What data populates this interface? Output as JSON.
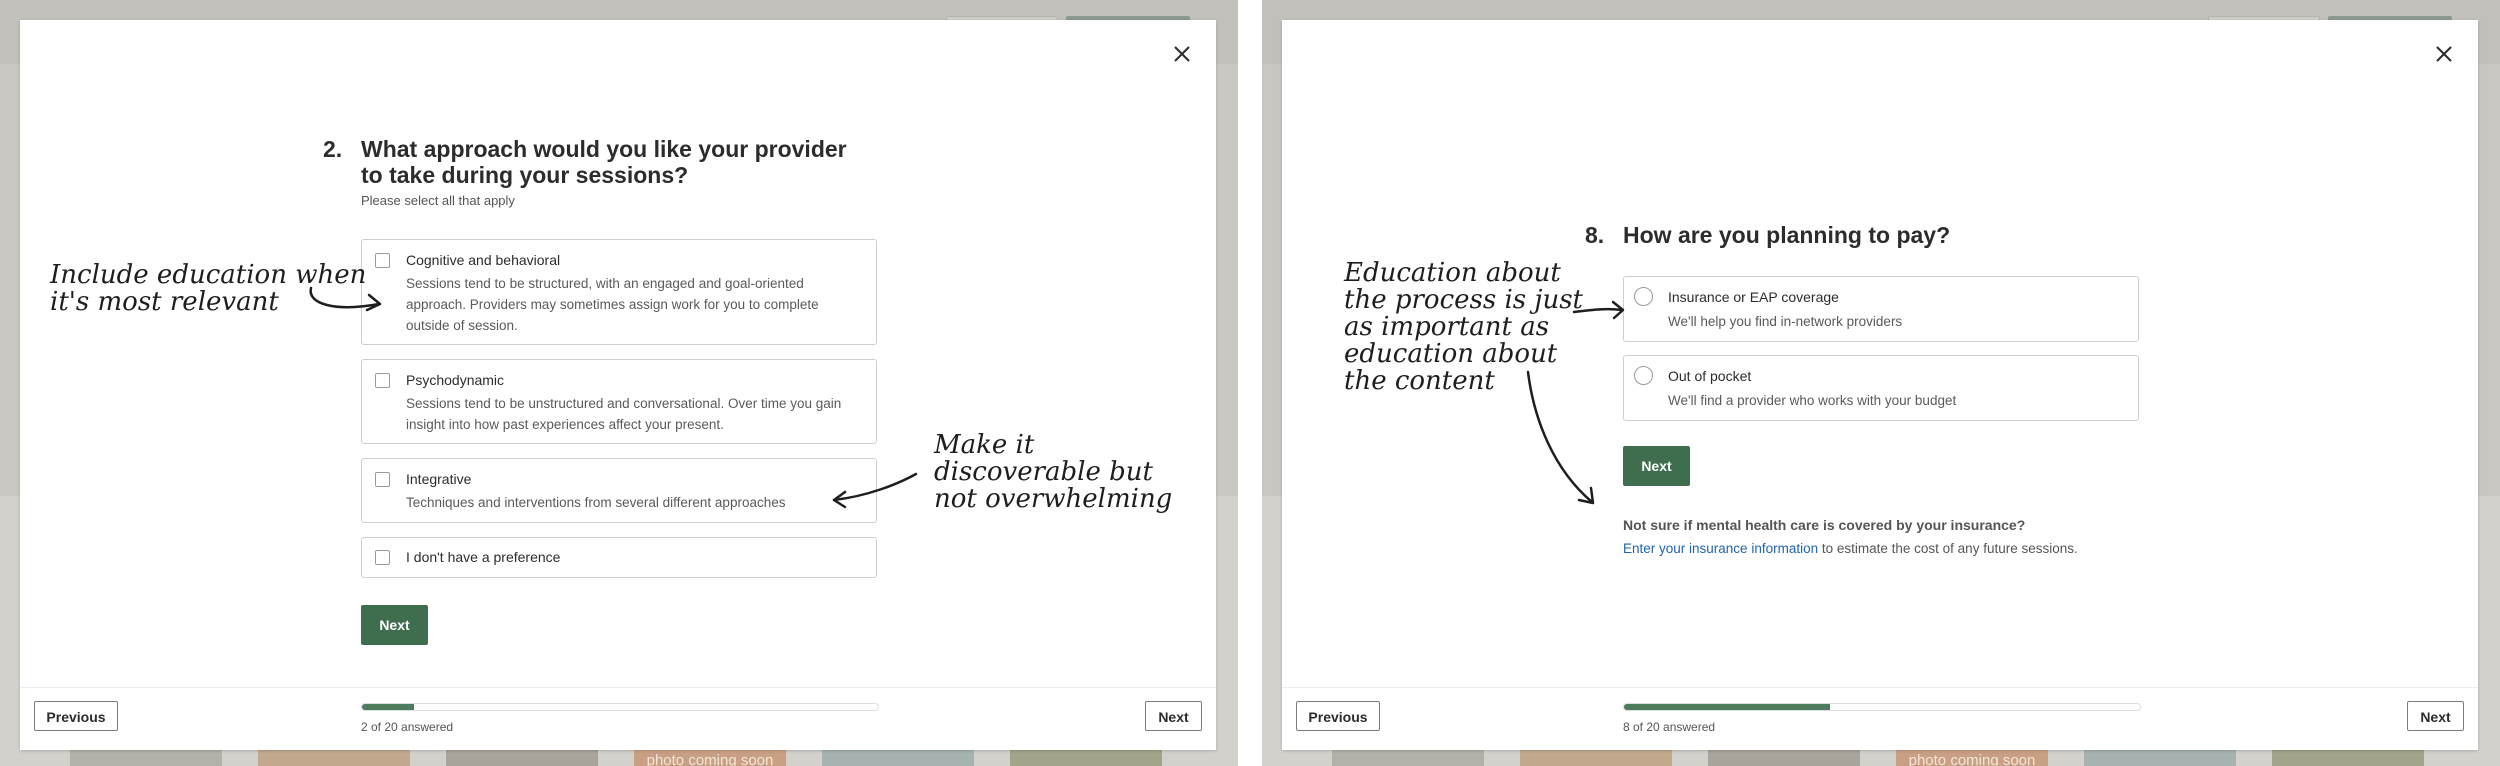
{
  "left": {
    "question": {
      "number": "2.",
      "title": "What approach would you like your provider to take during your sessions?",
      "subtitle": "Please select all that apply"
    },
    "options": [
      {
        "label": "Cognitive and behavioral",
        "description": "Sessions tend to be structured, with an engaged and goal-oriented approach. Providers may sometimes assign work for you to complete outside of session."
      },
      {
        "label": "Psychodynamic",
        "description": "Sessions tend to be unstructured and conversational. Over time you gain insight into how past experiences affect your present."
      },
      {
        "label": "Integrative",
        "description": "Techniques and interventions from several different approaches"
      },
      {
        "label": "I don't have a preference",
        "description": ""
      }
    ],
    "next_label": "Next",
    "footer": {
      "previous": "Previous",
      "next": "Next",
      "progress_text": "2 of 20 answered",
      "progress_fraction": 0.1
    },
    "annotations": {
      "education": "Include education when\nit's most relevant",
      "discoverable": "Make it\ndiscoverable but\nnot overwhelming"
    },
    "background": {
      "photo_label": "photo coming soon"
    }
  },
  "right": {
    "question": {
      "number": "8.",
      "title": "How are you planning to pay?"
    },
    "options": [
      {
        "label": "Insurance or EAP coverage",
        "description": "We'll help you find in-network providers"
      },
      {
        "label": "Out of pocket",
        "description": "We'll find a provider who works with your budget"
      }
    ],
    "next_label": "Next",
    "insurance_note": {
      "heading": "Not sure if mental health care is covered by your insurance?",
      "link": "Enter your insurance information",
      "rest": " to estimate the cost of any future sessions."
    },
    "footer": {
      "previous": "Previous",
      "next": "Next",
      "progress_text": "8 of 20 answered",
      "progress_fraction": 0.4
    },
    "annotations": {
      "process": "Education about\nthe process is just\nas important as\neducation about\nthe content"
    },
    "background": {
      "photo_label": "photo coming soon"
    }
  },
  "colors": {
    "primary_green": "#3f6e4f",
    "link_blue": "#1f64b0",
    "overlay": "#c9c7c2"
  },
  "icons": [
    "close-icon",
    "arrow-icon"
  ]
}
